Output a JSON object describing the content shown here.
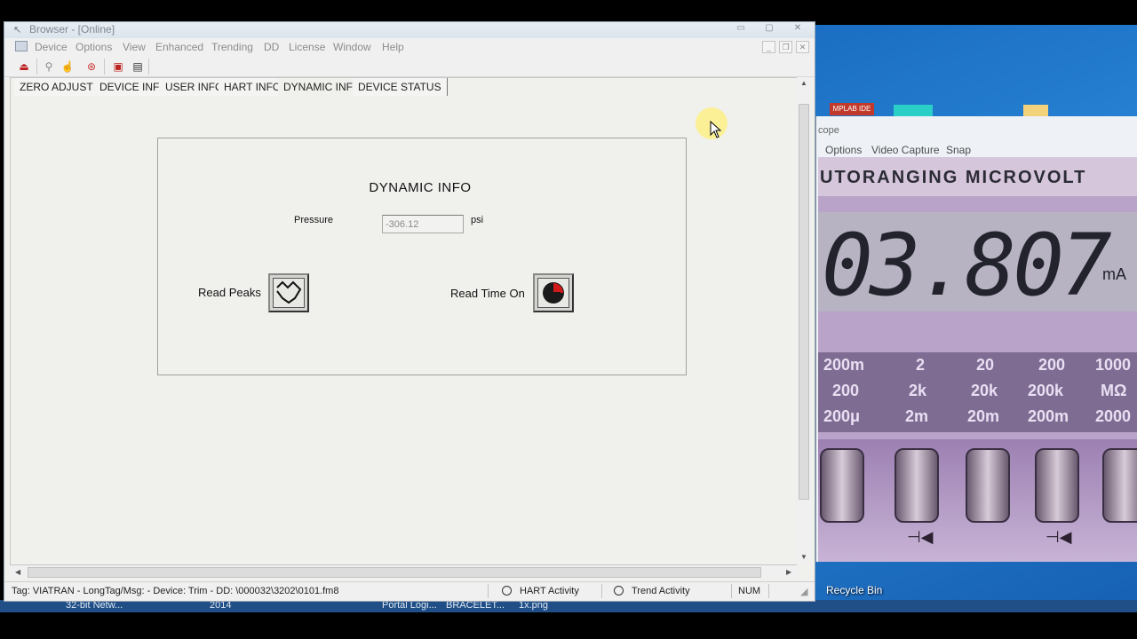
{
  "window": {
    "title": "Browser - [Online]",
    "menus": [
      "Device",
      "Options",
      "View",
      "Enhanced",
      "Trending",
      "DD",
      "License",
      "Window",
      "Help"
    ]
  },
  "tabs": [
    {
      "label": "ZERO ADJUST",
      "active": false
    },
    {
      "label": "DEVICE INFO",
      "active": false
    },
    {
      "label": "USER INFO",
      "active": false
    },
    {
      "label": "HART INFO",
      "active": false
    },
    {
      "label": "DYNAMIC INFO",
      "active": true
    },
    {
      "label": "DEVICE STATUS",
      "active": false
    }
  ],
  "panel": {
    "title": "DYNAMIC INFO",
    "pressure_label": "Pressure",
    "pressure_value": "-306.12",
    "pressure_unit": "psi",
    "read_peaks_label": "Read Peaks",
    "read_time_on_label": "Read Time On"
  },
  "statusbar": {
    "tag_info": "Tag: VIATRAN  - LongTag/Msg:  - Device: Trim - DD: \\000032\\3202\\0101.fm8",
    "hart_activity": "HART Activity",
    "trend_activity": "Trend Activity",
    "num": "NUM"
  },
  "desktop": {
    "recycle_bin": "Recycle Bin",
    "taskbar_items": [
      "32-bit Netw...",
      "2014",
      "Portal Logi...",
      "BRACELET...",
      "1x.png"
    ],
    "icon_label": "MPLAB IDE"
  },
  "video_window": {
    "title": "cope",
    "menus": [
      "Options",
      "Video Capture",
      "Snap"
    ],
    "banner_text": "UTORANGING MICROVOLT",
    "reading": "03.807",
    "unit": "mA",
    "range_rows": [
      [
        "200m",
        "2",
        "20",
        "200",
        "1000"
      ],
      [
        "200",
        "2k",
        "20k",
        "200k",
        "MΩ"
      ],
      [
        "200μ",
        "2m",
        "20m",
        "200m",
        "2000"
      ]
    ]
  },
  "colors": {
    "desktop_blue": "#1b6ec2",
    "window_bg": "#f0f0ed",
    "cursor_highlight": "#fff078"
  }
}
